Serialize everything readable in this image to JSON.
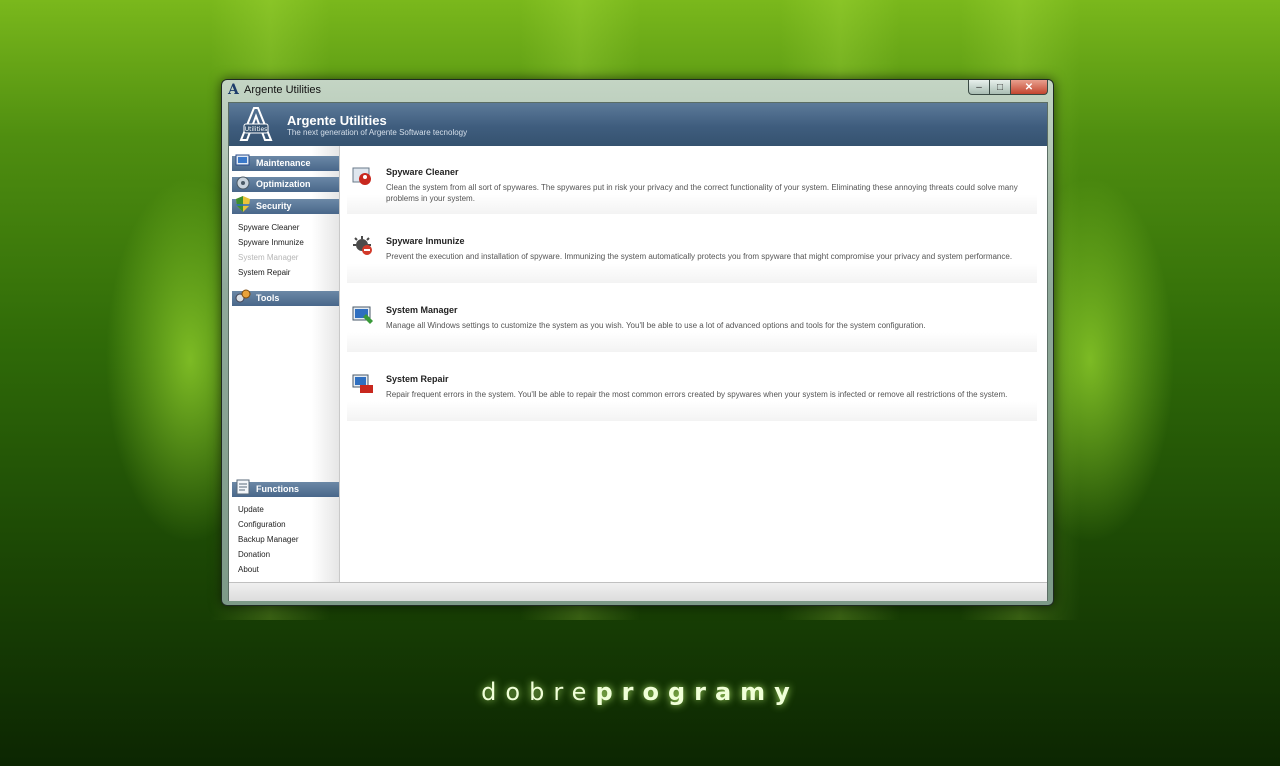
{
  "window": {
    "title": "Argente Utilities",
    "buttons": {
      "minimize": "–",
      "maximize": "□",
      "close": "✕"
    }
  },
  "header": {
    "logo_text": "Utilities",
    "title": "Argente Utilities",
    "subtitle": "The next generation of Argente Software tecnology"
  },
  "sidebar": {
    "sections": {
      "maintenance": "Maintenance",
      "optimization": "Optimization",
      "security": "Security",
      "tools": "Tools",
      "functions": "Functions"
    },
    "security_items": [
      "Spyware Cleaner",
      "Spyware Inmunize",
      "System Manager",
      "System Repair"
    ],
    "function_items": [
      "Update",
      "Configuration",
      "Backup Manager",
      "Donation",
      "About"
    ]
  },
  "main": {
    "items": [
      {
        "icon": "spyware-cleaner-icon",
        "title": "Spyware Cleaner",
        "desc": "Clean the system from all sort of spywares. The spywares put in risk your privacy and the correct functionality of your system. Eliminating these annoying threats could solve many problems in your system."
      },
      {
        "icon": "spyware-inmunize-icon",
        "title": "Spyware Inmunize",
        "desc": "Prevent the execution and installation of spyware. Immunizing the system automatically protects you from spyware that might compromise your privacy and system performance."
      },
      {
        "icon": "system-manager-icon",
        "title": "System Manager",
        "desc": "Manage all Windows settings to customize the system as you wish. You'll be able to use a lot of advanced options and tools for the system configuration."
      },
      {
        "icon": "system-repair-icon",
        "title": "System Repair",
        "desc": "Repair frequent errors in the system. You'll be able to repair the most common errors created by spywares when your system is infected or remove all restrictions of the system."
      }
    ]
  },
  "branding": {
    "light": "dobre",
    "bold": "programy"
  }
}
